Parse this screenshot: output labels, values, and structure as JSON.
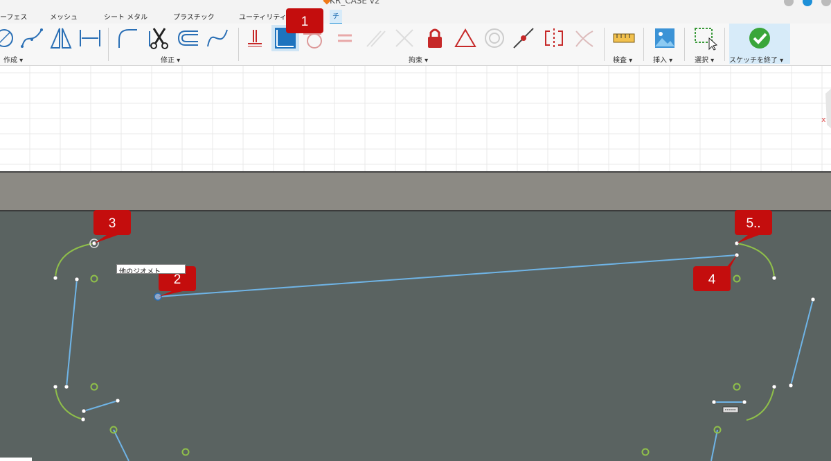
{
  "app": {
    "doc_title": "KR_CASE v2",
    "accent_color": "#1e90d8"
  },
  "tabs": [
    {
      "label": "ーフェス"
    },
    {
      "label": "メッシュ"
    },
    {
      "label": "シート メタル"
    },
    {
      "label": "プラスチック"
    },
    {
      "label": "ユーティリティ"
    },
    {
      "label": "スケッチ",
      "active": true,
      "visible_text": "チ"
    }
  ],
  "ribbon": {
    "groups": [
      {
        "id": "create",
        "label": "作成 ▾",
        "icons": [
          "circle-icon",
          "spline-icon",
          "triangle-icon",
          "dimension-width-icon"
        ]
      },
      {
        "id": "modify",
        "label": "修正 ▾",
        "icons": [
          "fillet-icon",
          "trim-scissors-icon",
          "offset-icon",
          "curve-icon"
        ]
      },
      {
        "id": "constraints",
        "label": "拘束 ▾",
        "icons": [
          "horizontal-vertical-icon",
          "coincident-icon",
          "tangent-icon",
          "equal-icon",
          "parallel-icon",
          "perpendicular-icon",
          "fix-lock-icon",
          "midpoint-icon",
          "concentric-icon",
          "collinear-icon",
          "symmetry-icon",
          "curvature-icon"
        ]
      },
      {
        "id": "inspect",
        "label": "検査 ▾",
        "icons": [
          "measure-icon"
        ]
      },
      {
        "id": "insert",
        "label": "挿入 ▾",
        "icons": [
          "image-icon"
        ]
      },
      {
        "id": "select",
        "label": "選択 ▾",
        "icons": [
          "select-window-icon"
        ]
      },
      {
        "id": "finish",
        "label": "スケッチを終了 ▾",
        "icons": [
          "finish-check-icon"
        ]
      }
    ]
  },
  "tooltip": {
    "text": "他のジオメト"
  },
  "callouts": [
    {
      "id": "1",
      "label": "1"
    },
    {
      "id": "2",
      "label": "2"
    },
    {
      "id": "3",
      "label": "3"
    },
    {
      "id": "4",
      "label": "4"
    },
    {
      "id": "5",
      "label": "5.."
    }
  ],
  "colors": {
    "sketch_line": "#6fb4e6",
    "arc": "#8fbf4a",
    "center_point": "#8fbf4a",
    "callout": "#c40d0d",
    "face": "#5a6361",
    "face_edge": "#8c8a84"
  }
}
